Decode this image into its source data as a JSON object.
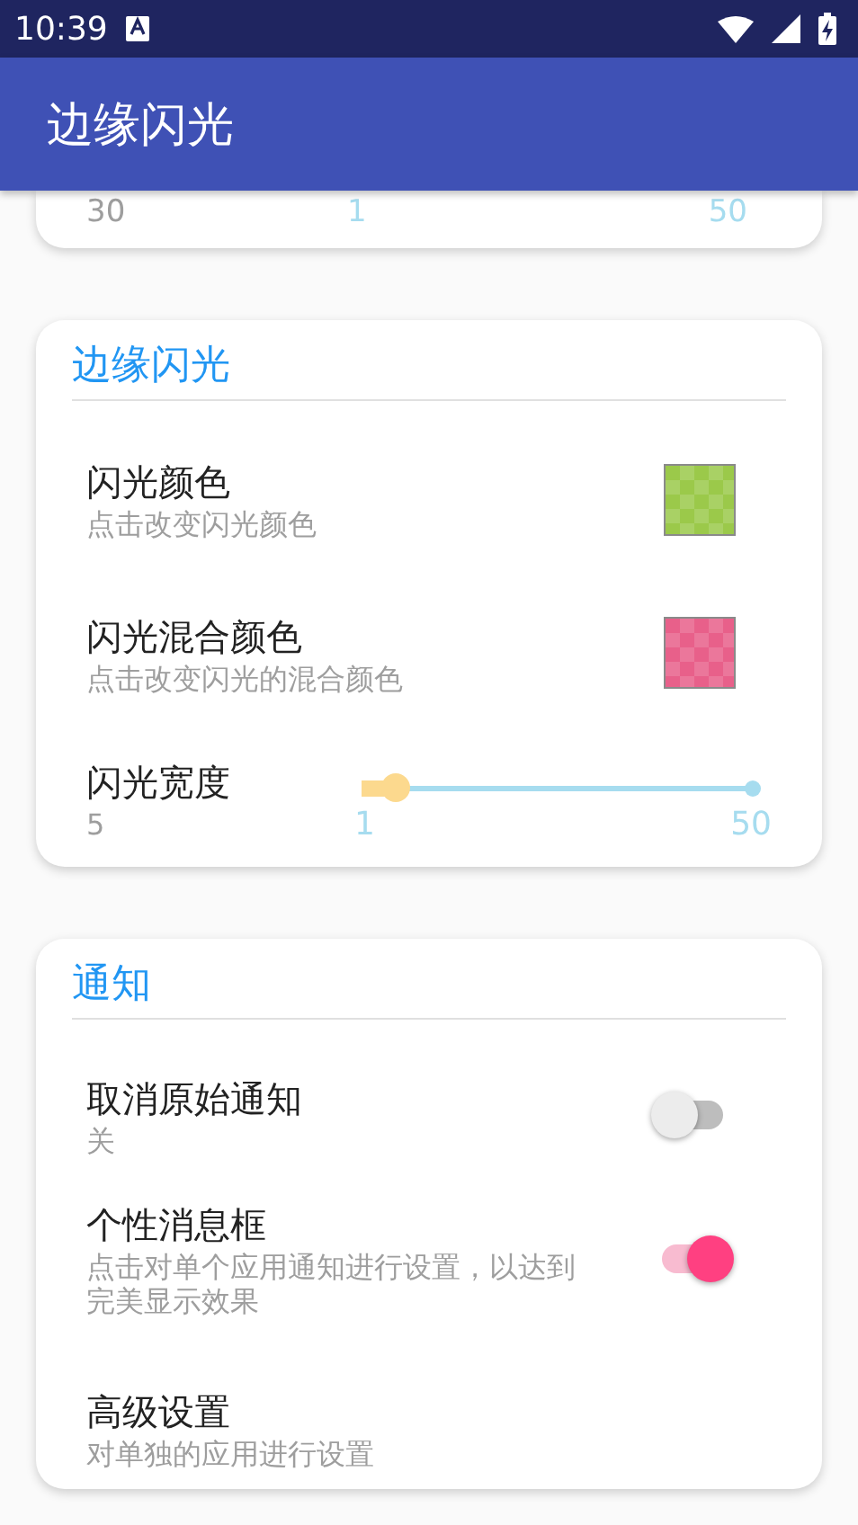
{
  "status_bar": {
    "time": "10:39"
  },
  "app_bar": {
    "title": "边缘闪光"
  },
  "partial_card": {
    "value": "30",
    "min": "1",
    "max": "50"
  },
  "sections": [
    {
      "title": "边缘闪光",
      "items": [
        {
          "kind": "color",
          "title": "闪光颜色",
          "subtitle": "点击改变闪光颜色",
          "color": "#9bc94a"
        },
        {
          "kind": "color",
          "title": "闪光混合颜色",
          "subtitle": "点击改变闪光的混合颜色",
          "color": "#e8608a"
        },
        {
          "kind": "slider",
          "title": "闪光宽度",
          "subtitle": "5",
          "level": 0.085,
          "min": "1",
          "max": "50"
        }
      ]
    },
    {
      "title": "通知",
      "items": [
        {
          "kind": "switch",
          "title": "取消原始通知",
          "subtitle": "关",
          "on": false
        },
        {
          "kind": "switch",
          "title": "个性消息框",
          "subtitle": "点击对单个应用通知进行设置，以达到完美显示效果",
          "on": true
        },
        {
          "kind": "link",
          "title": "高级设置",
          "subtitle": "对单独的应用进行设置"
        }
      ]
    }
  ]
}
